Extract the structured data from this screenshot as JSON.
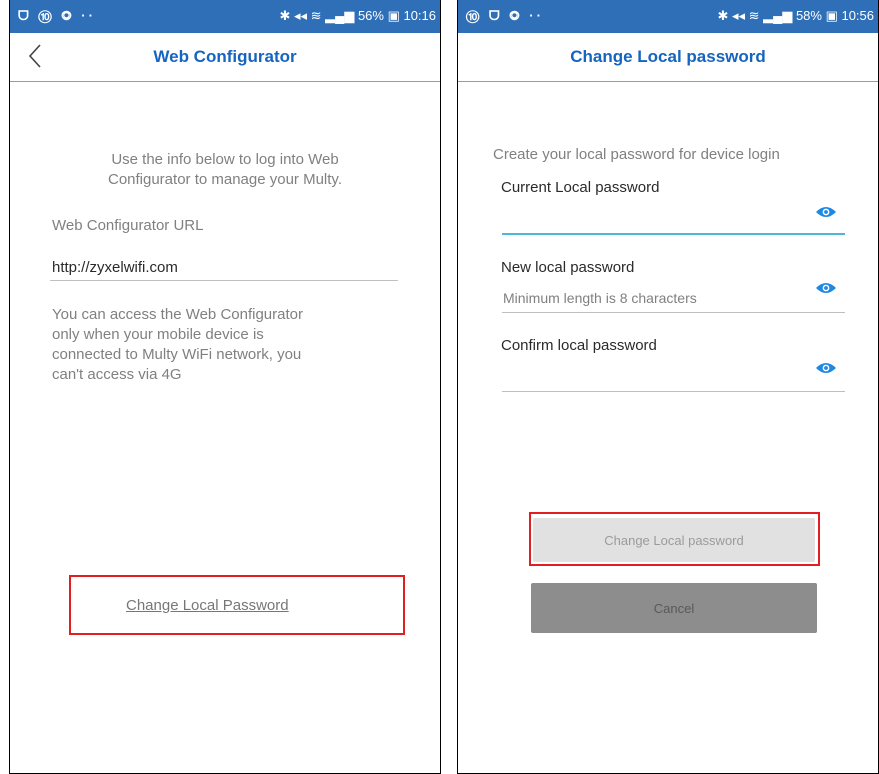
{
  "left": {
    "status": {
      "left_icons": "ᗜ ⑩ ◎ ··",
      "right": "✱ ◂◂ ≋ ▂▄▆ 56% ▣ 10:16"
    },
    "title": "Web Configurator",
    "intro": [
      "Use the info below to log into Web",
      "Configurator to manage your Multy."
    ],
    "url_label": "Web Configurator URL",
    "url_value": "http://zyxelwifi.com",
    "note": [
      "You can access the Web Configurator",
      "only when your mobile device is",
      "connected to Multy WiFi network, you",
      "can't access via 4G"
    ],
    "link": "Change Local Password"
  },
  "right": {
    "status": {
      "left_icons": "⑩ ᗜ ◎ ··",
      "right": "✱ ◂◂ ≋ ▂▄▆ 58% ▣ 10:56"
    },
    "title": "Change Local password",
    "intro": "Create your local password for device login",
    "current_label": "Current Local password",
    "new_label": "New local password",
    "new_placeholder": "Minimum length is 8 characters",
    "confirm_label": "Confirm local password",
    "change_button": "Change Local password",
    "cancel_button": "Cancel"
  },
  "colors": {
    "statusbar": "#2f6fb7",
    "accent": "#1565c0",
    "underline": "#4fb7d6",
    "highlight": "#e02020"
  },
  "icons": {
    "back": "chevron-left-icon",
    "eye": "eye-icon"
  }
}
